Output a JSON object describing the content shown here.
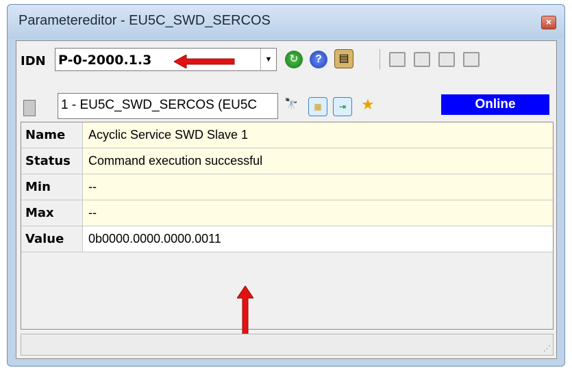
{
  "window": {
    "title": "Parametereditor - EU5C_SWD_SERCOS",
    "close_label": "×"
  },
  "toolbar": {
    "idn_label": "IDN",
    "idn_value": "P-0-2000.1.3",
    "icons": [
      "refresh-icon",
      "help-icon",
      "paste-icon",
      "write-icon",
      "read-icon",
      "list-icon",
      "check-icon"
    ]
  },
  "device": {
    "selector_text": "1 - EU5C_SWD_SERCOS (EU5C",
    "status": "Online",
    "icons": [
      "find-icon",
      "calendar-icon",
      "import-icon",
      "star-icon"
    ]
  },
  "params": [
    {
      "label": "Name",
      "value": "Acyclic Service SWD Slave 1"
    },
    {
      "label": "Status",
      "value": "Command execution successful"
    },
    {
      "label": "Min",
      "value": "--"
    },
    {
      "label": "Max",
      "value": "--"
    },
    {
      "label": "Value",
      "value": "0b0000.0000.0000.0011"
    }
  ],
  "colors": {
    "online_bg": "#0000ff",
    "arrow": "#e21212",
    "row_yellow": "#fffde3"
  }
}
